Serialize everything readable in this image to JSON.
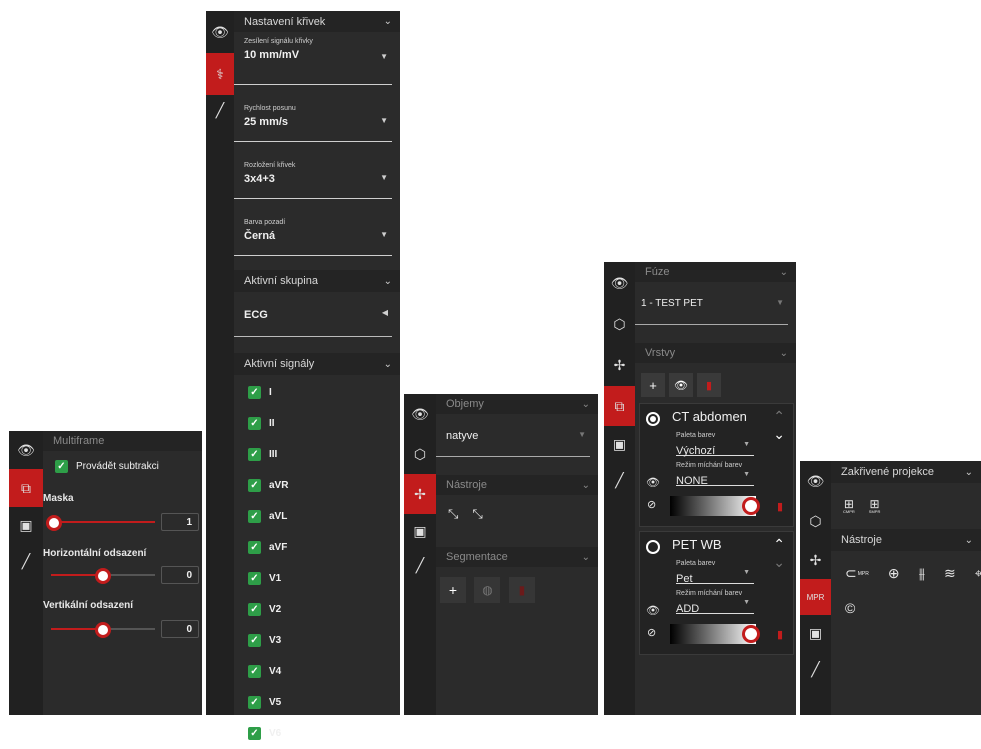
{
  "p1": {
    "header": "Multiframe",
    "checkbox": "Provádět subtrakci",
    "sliders": [
      {
        "label": "Maska",
        "value": "1"
      },
      {
        "label": "Horizontální odsazení",
        "value": "0"
      },
      {
        "label": "Vertikální odsazení",
        "value": "0"
      }
    ]
  },
  "p2": {
    "header1": "Nastavení křivek",
    "fields": [
      {
        "label": "Zesílení signálu křivky",
        "value": "10 mm/mV"
      },
      {
        "label": "Rychlost posunu",
        "value": "25 mm/s"
      },
      {
        "label": "Rozložení křivek",
        "value": "3x4+3"
      },
      {
        "label": "Barva pozadí",
        "value": "Černá"
      }
    ],
    "header2": "Aktivní skupina",
    "group_value": "ECG",
    "header3": "Aktivní signály",
    "signals": [
      "I",
      "II",
      "III",
      "aVR",
      "aVL",
      "aVF",
      "V1",
      "V2",
      "V3",
      "V4",
      "V5",
      "V6"
    ]
  },
  "p3": {
    "header1": "Objemy",
    "volume": "natyve",
    "header2": "Nástroje",
    "header3": "Segmentace"
  },
  "p4": {
    "header1": "Fúze",
    "fusion_value": "1 - TEST PET",
    "header2": "Vrstvy",
    "layers": [
      {
        "name": "CT abdomen",
        "palette_label": "Paleta barev",
        "palette": "Výchozí",
        "mix_label": "Režim míchání barev",
        "mix": "NONE"
      },
      {
        "name": "PET WB",
        "palette_label": "Paleta barev",
        "palette": "Pet",
        "mix_label": "Režim míchání barev",
        "mix": "ADD"
      }
    ]
  },
  "p5": {
    "header1": "Zakřivené projekce",
    "header2": "Nástroje",
    "mini1": "CMPR",
    "mini2": "SMPR",
    "tool_text": "MPR"
  }
}
